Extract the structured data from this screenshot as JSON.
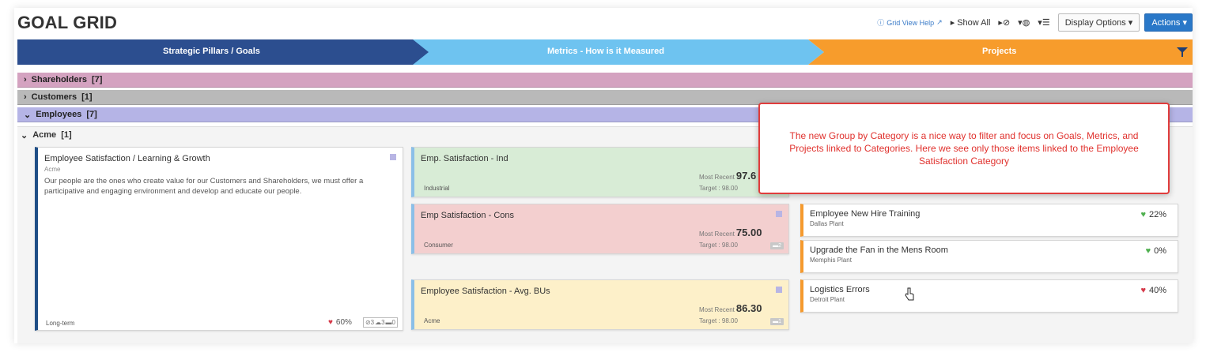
{
  "header": {
    "title": "GOAL GRID",
    "help_label": "Grid View Help",
    "show_all_label": "Show All",
    "display_options_label": "Display Options",
    "actions_label": "Actions"
  },
  "banner": {
    "col1": "Strategic Pillars / Goals",
    "col2": "Metrics - How is it Measured",
    "col3": "Projects",
    "colors": {
      "col1": "#2c4e8f",
      "col2": "#6ec3f0",
      "col3": "#f79c2c"
    }
  },
  "categories": [
    {
      "chevron": "›",
      "label": "Shareholders",
      "count": "[7]",
      "color": "#d4a2c0"
    },
    {
      "chevron": "›",
      "label": "Customers",
      "count": "[1]",
      "color": "#b9b9b9"
    },
    {
      "chevron": "⌄",
      "label": "Employees",
      "count": "[7]",
      "color": "#b5b4e6"
    }
  ],
  "group": {
    "chevron": "⌄",
    "label": "Acme",
    "count": "[1]"
  },
  "goal": {
    "title": "Employee Satisfaction / Learning & Growth",
    "subtitle": "Acme",
    "description": "Our people are the ones who create value for our Customers and Shareholders, we must offer a participative and engaging environment and develop and educate our people.",
    "term": "Long-term",
    "progress": "60%",
    "chips": [
      "⊘3",
      "☁3",
      "▬0"
    ]
  },
  "metrics": [
    {
      "title": "Emp. Satisfaction - Ind",
      "bu": "Industrial",
      "recent_label": "Most Recent",
      "recent_value": "97.6",
      "target": "Target : 98.00",
      "bg": "#d8ecd6",
      "badge": ""
    },
    {
      "title": "Emp Satisfaction - Cons",
      "bu": "Consumer",
      "recent_label": "Most Recent",
      "recent_value": "75.00",
      "target": "Target : 98.00",
      "bg": "#f3cfcf",
      "badge": "▬2"
    },
    {
      "title": "Employee Satisfaction - Avg. BUs",
      "bu": "Acme",
      "recent_label": "Most Recent",
      "recent_value": "86.30",
      "target": "Target : 98.00",
      "bg": "#fdf0c9",
      "badge": "▬1"
    }
  ],
  "projects": [
    {
      "title": "Employee New Hire Training",
      "location": "Dallas Plant",
      "pct": "22%",
      "heart_color": "#4fb04f"
    },
    {
      "title": "Upgrade the Fan in the Mens Room",
      "location": "Memphis Plant",
      "pct": "0%",
      "heart_color": "#4fb04f"
    },
    {
      "title": "Logistics Errors",
      "location": "Detroit Plant",
      "pct": "40%",
      "heart_color": "#d63a4a"
    }
  ],
  "callout": {
    "text": "The new Group by Category is a nice way to filter and focus on Goals, Metrics, and Projects linked to Categories. Here we see only those items linked to the Employee Satisfaction Category"
  },
  "icons": [
    "help-icon",
    "external-link-icon",
    "play-icon",
    "gauge-icon",
    "filter-icon",
    "heart-icon",
    "hand-cursor-icon"
  ]
}
